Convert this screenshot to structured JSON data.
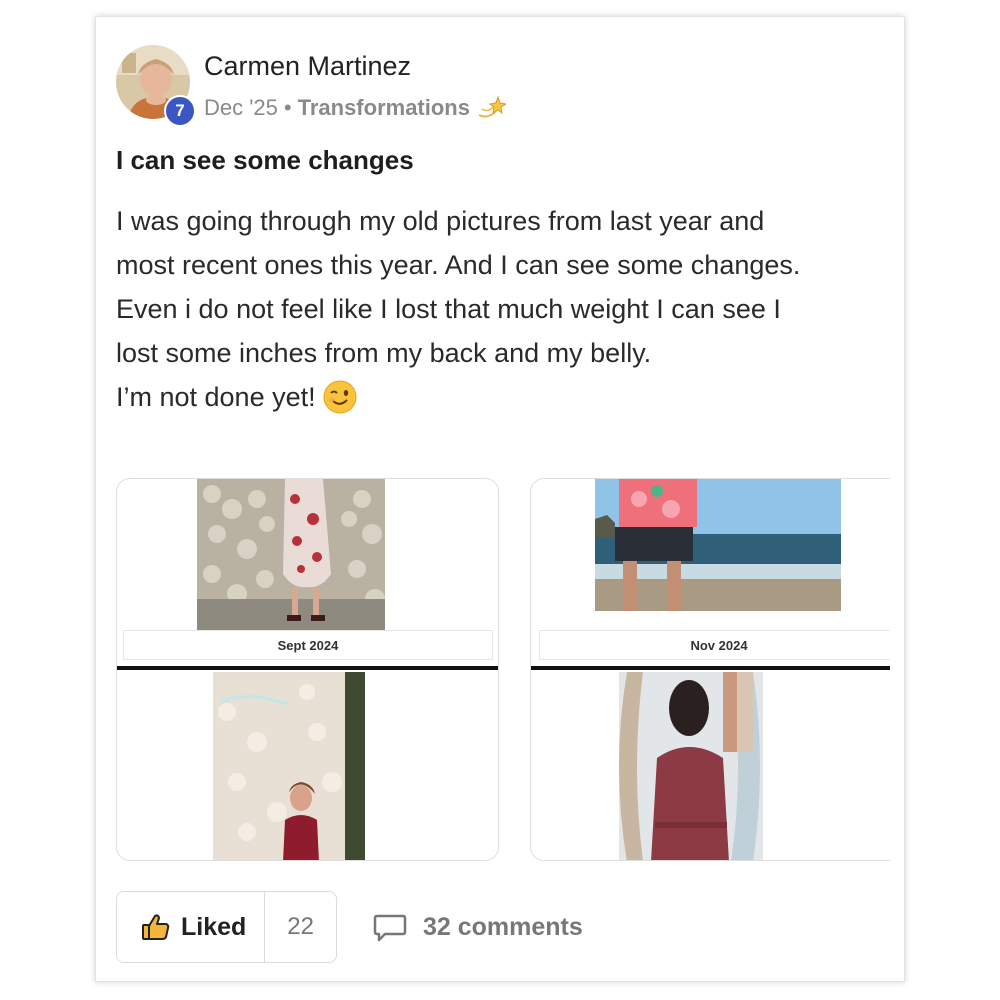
{
  "post": {
    "author": "Carmen Martinez",
    "level": "7",
    "date": "Dec '25",
    "separator": "•",
    "category": "Transformations",
    "category_icon": "dizzy-star-icon",
    "title": "I can see some changes",
    "body": [
      "I was going through my old pictures from last year and",
      "most recent ones this year. And I can see some changes.",
      "Even i do not feel like I lost that much weight I can see I",
      "lost some inches from my back and my belly.",
      "I’m not done yet! "
    ],
    "body_emoji": "winking-face-icon"
  },
  "attachments": [
    {
      "label": "Sept 2024"
    },
    {
      "label": "Nov 2024"
    }
  ],
  "actions": {
    "like_label": "Liked",
    "like_icon": "thumbs-up-icon",
    "like_count": "22",
    "comments_label": "32 comments",
    "comments_icon": "comment-bubble-icon"
  },
  "colors": {
    "badge": "#3b57c4",
    "meta_text": "#8a8a8a",
    "divider": "#111111"
  }
}
